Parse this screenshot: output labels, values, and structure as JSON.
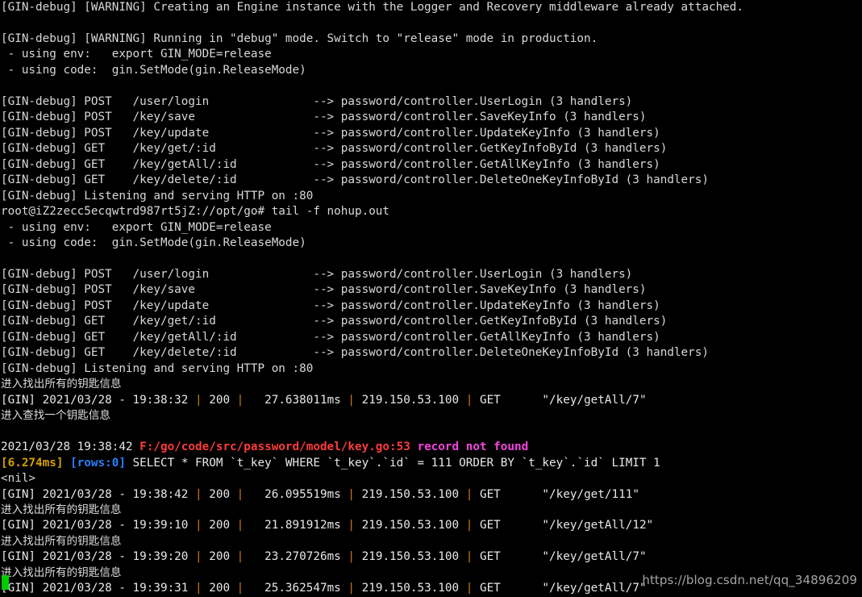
{
  "terminal": {
    "background_color": "#000000",
    "foreground_color": "#d8d8d8",
    "cursor_color": "#00cc00",
    "colors": {
      "red": "#ff3b3b",
      "magenta": "#f545e0",
      "yellow": "#d6a000",
      "cyan": "#2a7fff",
      "pipe": "#d07a18",
      "white": "#e8e8e8"
    },
    "watermark": "https://blog.csdn.net/qq_34896209",
    "lines": [
      {
        "id": "l1",
        "segments": [
          {
            "text": "[GIN-debug] [WARNING] Creating an Engine instance with the Logger and Recovery middleware already attached.",
            "color": "default"
          }
        ]
      },
      {
        "id": "l2",
        "segments": [
          {
            "text": "",
            "color": "default"
          }
        ]
      },
      {
        "id": "l3",
        "segments": [
          {
            "text": "[GIN-debug] [WARNING] Running in \"debug\" mode. Switch to \"release\" mode in production.",
            "color": "default"
          }
        ]
      },
      {
        "id": "l4",
        "segments": [
          {
            "text": " - using env:   export GIN_MODE=release",
            "color": "default"
          }
        ]
      },
      {
        "id": "l5",
        "segments": [
          {
            "text": " - using code:  gin.SetMode(gin.ReleaseMode)",
            "color": "default"
          }
        ]
      },
      {
        "id": "l6",
        "segments": [
          {
            "text": "",
            "color": "default"
          }
        ]
      },
      {
        "id": "l7",
        "segments": [
          {
            "text": "[GIN-debug] POST   /user/login               --> password/controller.UserLogin (3 handlers)",
            "color": "default"
          }
        ]
      },
      {
        "id": "l8",
        "segments": [
          {
            "text": "[GIN-debug] POST   /key/save                 --> password/controller.SaveKeyInfo (3 handlers)",
            "color": "default"
          }
        ]
      },
      {
        "id": "l9",
        "segments": [
          {
            "text": "[GIN-debug] POST   /key/update               --> password/controller.UpdateKeyInfo (3 handlers)",
            "color": "default"
          }
        ]
      },
      {
        "id": "l10",
        "segments": [
          {
            "text": "[GIN-debug] GET    /key/get/:id              --> password/controller.GetKeyInfoById (3 handlers)",
            "color": "default"
          }
        ]
      },
      {
        "id": "l11",
        "segments": [
          {
            "text": "[GIN-debug] GET    /key/getAll/:id           --> password/controller.GetAllKeyInfo (3 handlers)",
            "color": "default"
          }
        ]
      },
      {
        "id": "l12",
        "segments": [
          {
            "text": "[GIN-debug] GET    /key/delete/:id           --> password/controller.DeleteOneKeyInfoById (3 handlers)",
            "color": "default"
          }
        ]
      },
      {
        "id": "l13",
        "segments": [
          {
            "text": "[GIN-debug] Listening and serving HTTP on :80",
            "color": "default"
          }
        ]
      },
      {
        "id": "l14",
        "segments": [
          {
            "text": "root@iZ2zecc5ecqwtrd987rt5jZ://opt/go# tail -f nohup.out",
            "color": "default"
          }
        ]
      },
      {
        "id": "l15",
        "segments": [
          {
            "text": " - using env:   export GIN_MODE=release",
            "color": "default"
          }
        ]
      },
      {
        "id": "l16",
        "segments": [
          {
            "text": " - using code:  gin.SetMode(gin.ReleaseMode)",
            "color": "default"
          }
        ]
      },
      {
        "id": "l17",
        "segments": [
          {
            "text": "",
            "color": "default"
          }
        ]
      },
      {
        "id": "l18",
        "segments": [
          {
            "text": "[GIN-debug] POST   /user/login               --> password/controller.UserLogin (3 handlers)",
            "color": "default"
          }
        ]
      },
      {
        "id": "l19",
        "segments": [
          {
            "text": "[GIN-debug] POST   /key/save                 --> password/controller.SaveKeyInfo (3 handlers)",
            "color": "default"
          }
        ]
      },
      {
        "id": "l20",
        "segments": [
          {
            "text": "[GIN-debug] POST   /key/update               --> password/controller.UpdateKeyInfo (3 handlers)",
            "color": "default"
          }
        ]
      },
      {
        "id": "l21",
        "segments": [
          {
            "text": "[GIN-debug] GET    /key/get/:id              --> password/controller.GetKeyInfoById (3 handlers)",
            "color": "default"
          }
        ]
      },
      {
        "id": "l22",
        "segments": [
          {
            "text": "[GIN-debug] GET    /key/getAll/:id           --> password/controller.GetAllKeyInfo (3 handlers)",
            "color": "default"
          }
        ]
      },
      {
        "id": "l23",
        "segments": [
          {
            "text": "[GIN-debug] GET    /key/delete/:id           --> password/controller.DeleteOneKeyInfoById (3 handlers)",
            "color": "default"
          }
        ]
      },
      {
        "id": "l24",
        "segments": [
          {
            "text": "[GIN-debug] Listening and serving HTTP on :80",
            "color": "default"
          }
        ]
      },
      {
        "id": "l25",
        "segments": [
          {
            "text": "进入找出所有的钥匙信息",
            "color": "cn"
          }
        ]
      },
      {
        "id": "l26",
        "segments": [
          {
            "text": "[GIN] 2021/03/28 - 19:38:32 ",
            "color": "white"
          },
          {
            "text": "|",
            "color": "pipe"
          },
          {
            "text": " 200 ",
            "color": "white"
          },
          {
            "text": "|",
            "color": "pipe"
          },
          {
            "text": "   27.638011ms ",
            "color": "white"
          },
          {
            "text": "|",
            "color": "pipe"
          },
          {
            "text": " 219.150.53.100 ",
            "color": "white"
          },
          {
            "text": "|",
            "color": "pipe"
          },
          {
            "text": " GET      \"/key/getAll/7\"",
            "color": "white"
          }
        ]
      },
      {
        "id": "l27",
        "segments": [
          {
            "text": "进入查找一个钥匙信息",
            "color": "cn"
          }
        ]
      },
      {
        "id": "l28",
        "segments": [
          {
            "text": "",
            "color": "default"
          }
        ]
      },
      {
        "id": "l29",
        "segments": [
          {
            "text": "2021/03/28 19:38:42 ",
            "color": "white"
          },
          {
            "text": "F:/go/code/src/password/model/key.go:53",
            "color": "red"
          },
          {
            "text": " ",
            "color": "white"
          },
          {
            "text": "record not found",
            "color": "magenta"
          }
        ]
      },
      {
        "id": "l30",
        "segments": [
          {
            "text": "[6.274ms] ",
            "color": "yellow"
          },
          {
            "text": "[rows:0]",
            "color": "cyan"
          },
          {
            "text": " SELECT * FROM `t_key` WHERE `t_key`.`id` = 111 ORDER BY `t_key`.`id` LIMIT 1",
            "color": "white"
          }
        ]
      },
      {
        "id": "l31",
        "segments": [
          {
            "text": "<nil>",
            "color": "default"
          }
        ]
      },
      {
        "id": "l32",
        "segments": [
          {
            "text": "[GIN] 2021/03/28 - 19:38:42 ",
            "color": "white"
          },
          {
            "text": "|",
            "color": "pipe"
          },
          {
            "text": " 200 ",
            "color": "white"
          },
          {
            "text": "|",
            "color": "pipe"
          },
          {
            "text": "   26.095519ms ",
            "color": "white"
          },
          {
            "text": "|",
            "color": "pipe"
          },
          {
            "text": " 219.150.53.100 ",
            "color": "white"
          },
          {
            "text": "|",
            "color": "pipe"
          },
          {
            "text": " GET      \"/key/get/111\"",
            "color": "white"
          }
        ]
      },
      {
        "id": "l33",
        "segments": [
          {
            "text": "进入找出所有的钥匙信息",
            "color": "cn"
          }
        ]
      },
      {
        "id": "l34",
        "segments": [
          {
            "text": "[GIN] 2021/03/28 - 19:39:10 ",
            "color": "white"
          },
          {
            "text": "|",
            "color": "pipe"
          },
          {
            "text": " 200 ",
            "color": "white"
          },
          {
            "text": "|",
            "color": "pipe"
          },
          {
            "text": "   21.891912ms ",
            "color": "white"
          },
          {
            "text": "|",
            "color": "pipe"
          },
          {
            "text": " 219.150.53.100 ",
            "color": "white"
          },
          {
            "text": "|",
            "color": "pipe"
          },
          {
            "text": " GET      \"/key/getAll/12\"",
            "color": "white"
          }
        ]
      },
      {
        "id": "l35",
        "segments": [
          {
            "text": "进入找出所有的钥匙信息",
            "color": "cn"
          }
        ]
      },
      {
        "id": "l36",
        "segments": [
          {
            "text": "[GIN] 2021/03/28 - 19:39:20 ",
            "color": "white"
          },
          {
            "text": "|",
            "color": "pipe"
          },
          {
            "text": " 200 ",
            "color": "white"
          },
          {
            "text": "|",
            "color": "pipe"
          },
          {
            "text": "   23.270726ms ",
            "color": "white"
          },
          {
            "text": "|",
            "color": "pipe"
          },
          {
            "text": " 219.150.53.100 ",
            "color": "white"
          },
          {
            "text": "|",
            "color": "pipe"
          },
          {
            "text": " GET      \"/key/getAll/7\"",
            "color": "white"
          }
        ]
      },
      {
        "id": "l37",
        "segments": [
          {
            "text": "进入找出所有的钥匙信息",
            "color": "cn"
          }
        ]
      },
      {
        "id": "l38",
        "segments": [
          {
            "text": "[GIN] 2021/03/28 - 19:39:31 ",
            "color": "white"
          },
          {
            "text": "|",
            "color": "pipe"
          },
          {
            "text": " 200 ",
            "color": "white"
          },
          {
            "text": "|",
            "color": "pipe"
          },
          {
            "text": "   25.362547ms ",
            "color": "white"
          },
          {
            "text": "|",
            "color": "pipe"
          },
          {
            "text": " 219.150.53.100 ",
            "color": "white"
          },
          {
            "text": "|",
            "color": "pipe"
          },
          {
            "text": " GET      \"/key/getAll/7\"",
            "color": "white"
          }
        ]
      }
    ]
  }
}
